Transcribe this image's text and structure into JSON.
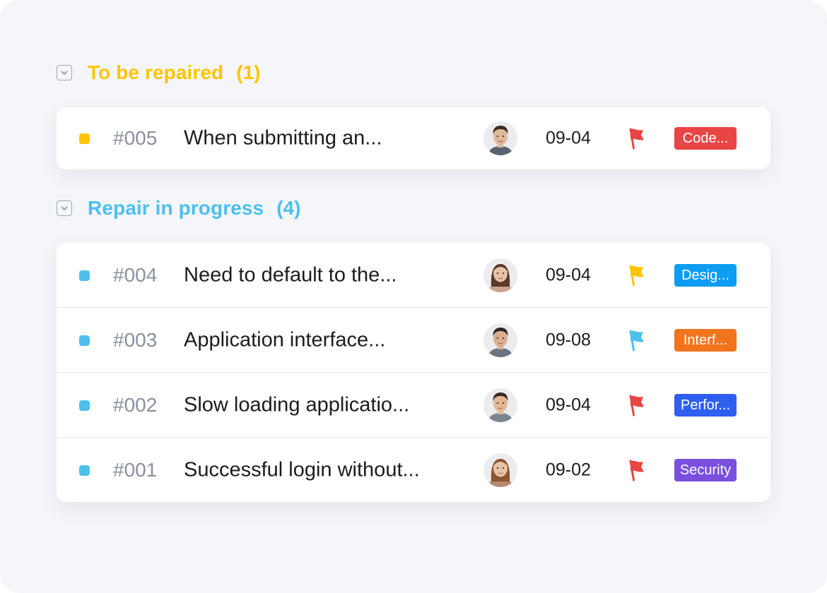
{
  "groups": [
    {
      "title": "To be repaired",
      "count": "(1)",
      "color": "#ffc400",
      "toggle_icon": "chevron-down-icon",
      "issues": [
        {
          "id": "#005",
          "title": "When submitting an...",
          "date": "09-04",
          "flag_color": "#e94545",
          "tag": "Code...",
          "tag_color": "#e94545",
          "avatar": "man-1",
          "status_color": "#ffc400"
        }
      ]
    },
    {
      "title": "Repair in progress",
      "count": "(4)",
      "color": "#4cc0ec",
      "toggle_icon": "chevron-down-icon",
      "issues": [
        {
          "id": "#004",
          "title": "Need to default to the...",
          "date": "09-04",
          "flag_color": "#ffc400",
          "tag": "Desig...",
          "tag_color": "#0d9cf2",
          "avatar": "woman-1",
          "status_color": "#4cc0ec"
        },
        {
          "id": "#003",
          "title": "Application interface...",
          "date": "09-08",
          "flag_color": "#4cc0ec",
          "tag": "Interf...",
          "tag_color": "#f2741d",
          "avatar": "man-2",
          "status_color": "#4cc0ec"
        },
        {
          "id": "#002",
          "title": "Slow loading applicatio...",
          "date": "09-04",
          "flag_color": "#e94545",
          "tag": "Perfor...",
          "tag_color": "#2f5ff0",
          "avatar": "man-3",
          "status_color": "#4cc0ec"
        },
        {
          "id": "#001",
          "title": "Successful login without...",
          "date": "09-02",
          "flag_color": "#e94545",
          "tag": "Security",
          "tag_color": "#7a4fe0",
          "avatar": "woman-2",
          "status_color": "#4cc0ec"
        }
      ]
    }
  ]
}
